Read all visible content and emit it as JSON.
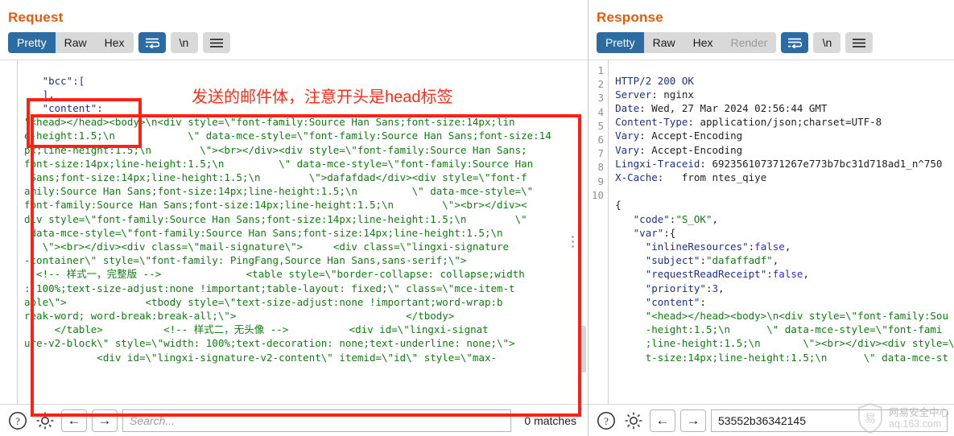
{
  "request": {
    "title": "Request",
    "tabs": [
      {
        "label": "Pretty",
        "active": true
      },
      {
        "label": "Raw",
        "active": false
      },
      {
        "label": "Hex",
        "active": false
      }
    ],
    "buttons": {
      "wrap": "wrap-lines-icon",
      "newline": "\\n",
      "menu": "hamburger-menu-icon"
    },
    "body_lines": [
      "   \"bcc\":[",
      "   ],",
      "   \"content\":",
      "\"<head></head><body>\\n<div style=\\\"font-family:Source Han Sans;font-size:14px;lin",
      "e-height:1.5;\\n            \\\" data-mce-style=\\\"font-family:Source Han Sans;font-size:14",
      "px;line-height:1.5;\\n        \\\"><br></div><div style=\\\"font-family:Source Han Sans;",
      "font-size:14px;line-height:1.5;\\n         \\\" data-mce-style=\\\"font-family:Source Han",
      " Sans;font-size:14px;line-height:1.5;\\n        \\\">dafafdad</div><div style=\\\"font-f",
      "amily:Source Han Sans;font-size:14px;line-height:1.5;\\n         \\\" data-mce-style=\\\"",
      "font-family:Source Han Sans;font-size:14px;line-height:1.5;\\n        \\\"><br></div><",
      "div style=\\\"font-family:Source Han Sans;font-size:14px;line-height:1.5;\\n        \\\"",
      " data-mce-style=\\\"font-family:Source Han Sans;font-size:14px;line-height:1.5;\\n",
      "   \\\"><br></div><div class=\\\"mail-signature\\\">     <div class=\\\"lingxi-signature",
      "-container\\\" style=\\\"font-family: PingFang,Source Han Sans,sans-serif;\\\">",
      "  <!-- 样式一，完整版 -->              <table style=\\\"border-collapse: collapse;width",
      ": 100%;text-size-adjust:none !important;table-layout: fixed;\\\" class=\\\"mce-item-t",
      "able\\\">             <tbody style=\\\"text-size-adjust:none !important;word-wrap:b",
      "reak-word; word-break:break-all;\\\">                            </tbody>",
      "     </table>          <!-- 样式二，无头像 -->          <div id=\\\"lingxi-signat",
      "ure-v2-block\\\" style=\\\"width: 100%;text-decoration: none;text-underline: none;\\\">",
      "            <div id=\\\"lingxi-signature-v2-content\\\" itemid=\\\"id\\\" style=\\\"max-"
    ],
    "annotation": "发送的邮件体，注意开头是head标签",
    "annotation_color": "#ff2d18"
  },
  "response": {
    "title": "Response",
    "tabs": [
      {
        "label": "Pretty",
        "active": true
      },
      {
        "label": "Raw",
        "active": false
      },
      {
        "label": "Hex",
        "active": false
      },
      {
        "label": "Render",
        "active": false,
        "disabled": true
      }
    ],
    "buttons": {
      "wrap": "wrap-lines-icon",
      "newline": "\\n",
      "menu": "hamburger-menu-icon"
    },
    "line_numbers": [
      "1",
      "2",
      "3",
      "4",
      "5",
      "6",
      "7",
      "8",
      "9",
      "10"
    ],
    "headers": [
      {
        "name": "HTTP/2 200 OK",
        "value": ""
      },
      {
        "name": "Server",
        "value": "nginx"
      },
      {
        "name": "Date",
        "value": "Wed, 27 Mar 2024 02:56:44 GMT"
      },
      {
        "name": "Content-Type",
        "value": "application/json;charset=UTF-8"
      },
      {
        "name": "Vary",
        "value": "Accept-Encoding"
      },
      {
        "name": "Vary",
        "value": "Accept-Encoding"
      },
      {
        "name": "Lingxi-Traceid",
        "value": "692356107371267e773b7bc31d718ad1_n^750"
      },
      {
        "name": "X-Cache",
        "value": "  from ntes_qiye"
      }
    ],
    "body_lines": [
      "{",
      "   \"code\":\"S_OK\",",
      "   \"var\":{",
      "     \"inlineResources\":false,",
      "     \"subject\":\"dafaffadf\",",
      "     \"requestReadReceipt\":false,",
      "     \"priority\":3,",
      "     \"content\":",
      "     \"<head></head><body>\\n<div style=\\\"font-family:Sou",
      "     -height:1.5;\\n      \\\" data-mce-style=\\\"font-fami",
      "     ;line-height:1.5;\\n       \\\"><br></div><div style=\\\"",
      "     t-size:14px;line-height:1.5;\\n      \\\" data-mce-st"
    ]
  },
  "bottom_left": {
    "help_icon": "question-mark-icon",
    "settings_icon": "gear-icon",
    "back_icon": "arrow-left-icon",
    "forward_icon": "arrow-right-icon",
    "search_value": "",
    "search_placeholder": "Search...",
    "matches": "0 matches"
  },
  "bottom_right": {
    "help_icon": "question-mark-icon",
    "settings_icon": "gear-icon",
    "back_icon": "arrow-left-icon",
    "forward_icon": "arrow-right-icon",
    "search_value": "53552b36342145",
    "search_placeholder": ""
  },
  "watermark": {
    "logo_glyph": "易",
    "cn": "网易安全中心",
    "url": "aq.163.com"
  }
}
